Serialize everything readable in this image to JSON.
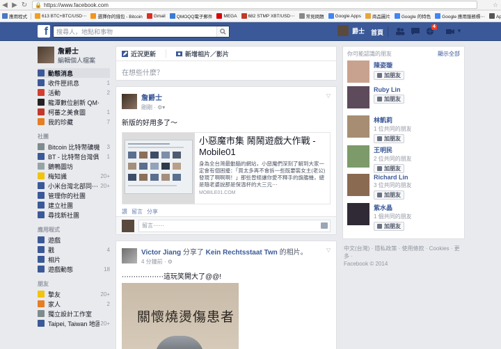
{
  "browser": {
    "url": "https://www.facebook.com",
    "bookmarks": [
      {
        "label": "應用程式",
        "color": "#4a78c2"
      },
      {
        "label": "613 BTC+BTC/USD⋯",
        "color": "#f0a020"
      },
      {
        "label": "選擇你的錢包 - Bitcoin",
        "color": "#f7931a"
      },
      {
        "label": "Gmail",
        "color": "#d93025"
      },
      {
        "label": "QMOQQ電子郵件",
        "color": "#3a7bd5"
      },
      {
        "label": "MEGA",
        "color": "#d90007"
      },
      {
        "label": "682 STMP XBT/USD⋯",
        "color": "#c0392b"
      },
      {
        "label": "常見問題",
        "color": "#888888"
      },
      {
        "label": "Google Apps",
        "color": "#4285f4"
      },
      {
        "label": "商品圖片",
        "color": "#e8a33d"
      },
      {
        "label": "Google 的特色",
        "color": "#4285f4"
      },
      {
        "label": "Google 應用服務標⋯",
        "color": "#4285f4"
      },
      {
        "label": "Apple - 台灣",
        "color": "#555555"
      }
    ]
  },
  "header": {
    "search_placeholder": "搜尋人，地點和事物",
    "profile_name": "爵士",
    "home_label": "首頁",
    "notification_count": "4"
  },
  "left": {
    "user_name": "詹爵士",
    "edit_profile": "編輯個人檔案",
    "items": [
      {
        "label": "動態消息",
        "count": "",
        "active": true,
        "color": "#3b5998"
      },
      {
        "label": "收件匣訊息",
        "count": "1",
        "color": "#3b5998"
      },
      {
        "label": "活動",
        "count": "2",
        "color": "#d23f31"
      },
      {
        "label": "龍潭數位創新 QM⋯",
        "count": "",
        "color": "#222222"
      },
      {
        "label": "柯蕃之美食圖",
        "count": "1",
        "color": "#c0392b"
      },
      {
        "label": "我的珍藏",
        "count": "7",
        "color": "#e67e22"
      }
    ],
    "groups_header": "社團",
    "groups": [
      {
        "label": "Bitcoin 比特幣礦機⋯",
        "count": "3",
        "color": "#7f8c8d"
      },
      {
        "label": "BT - 比特幣台灣俱⋯",
        "count": "1",
        "color": "#3b5998"
      },
      {
        "label": "鵝鴨圖坊",
        "count": "",
        "color": "#95a5a6"
      },
      {
        "label": "梅知識",
        "count": "20+",
        "color": "#f1c40f"
      },
      {
        "label": "小米台灣北部同⋯",
        "count": "20+",
        "color": "#3b5998"
      },
      {
        "label": "管理你的社團",
        "count": "",
        "color": "#3b5998"
      },
      {
        "label": "建立社團",
        "count": "",
        "color": "#3b5998"
      },
      {
        "label": "尋找新社團",
        "count": "",
        "color": "#3b5998"
      }
    ],
    "apps_header": "應用程式",
    "apps": [
      {
        "label": "遊戲",
        "count": "",
        "color": "#3b5998"
      },
      {
        "label": "戳",
        "count": "4",
        "color": "#3b5998"
      },
      {
        "label": "相片",
        "count": "",
        "color": "#3b5998"
      },
      {
        "label": "遊戲動態",
        "count": "18",
        "color": "#3b5998"
      }
    ],
    "friends_header": "朋友",
    "friends": [
      {
        "label": "摯友",
        "count": "20+",
        "color": "#f1c40f"
      },
      {
        "label": "家人",
        "count": "2",
        "color": "#e67e22"
      },
      {
        "label": "獨立設計工作室",
        "count": "",
        "color": "#7f8c8d"
      },
      {
        "label": "Taipei, Taiwan 地區",
        "count": "20+",
        "color": "#3b5998"
      }
    ]
  },
  "composer": {
    "status_tab": "近況更新",
    "photo_tab": "新增相片／影片",
    "placeholder": "在想些什麼？"
  },
  "post1": {
    "author": "詹爵士",
    "time": "剛剛",
    "text": "新版的好用多了～",
    "link_title": "小惡魔市集 鬧鬧遊戲大作戰 - Mobile01",
    "link_desc": "身為全台灣最動腦的網站，小惡魔們深刻了解到大家一定會有個困擾：「買太多再不會拆一些既要裝女主(老公)發現了啊啊啊！」那些曾經讓你愛不釋手的旗艦機，總是隨老婆說那是保溫杯的大三元⋯",
    "link_source": "MOBILE01.COM",
    "actions": [
      "讚",
      "留言",
      "分享"
    ],
    "comment_placeholder": "留言⋯⋯"
  },
  "post2": {
    "author": "Victor Jiang",
    "shared_text": "分享了",
    "page_name": "Kein Rechtsstaat Twn",
    "suffix": "的相片。",
    "time": "4 分鐘前",
    "text": "⋯⋯⋯⋯⋯⋯這玩笑開大了@@!",
    "image_caption": "關懷燒燙傷患者"
  },
  "right": {
    "title": "你可能認識的朋友",
    "see_all": "顯示全部",
    "add_label": "加朋友",
    "people": [
      {
        "name": "陳姿璇",
        "mutual": "",
        "color": "#c9a28f"
      },
      {
        "name": "Ruby Lin",
        "mutual": "",
        "color": "#5d4a5a"
      },
      {
        "name": "林凱莉",
        "mutual": "1 位共同的朋友",
        "color": "#a78d72"
      },
      {
        "name": "王明民",
        "mutual": "2 位共同的朋友",
        "color": "#7c9a6a"
      },
      {
        "name": "Richard Lin",
        "mutual": "3 位共同的朋友",
        "color": "#8b6a52"
      },
      {
        "name": "紫水晶",
        "mutual": "1 個共同的朋友",
        "color": "#2f2a35"
      }
    ]
  },
  "footer": {
    "links": "中文(台灣) · 隱私政策 · 使用條款 · Cookies · 更多 ·",
    "copyright": "Facebook © 2014"
  },
  "colors": {
    "brand": "#3b5998",
    "link": "#3b5998",
    "badge": "#f03d25"
  },
  "icons": [
    "back-icon",
    "forward-icon",
    "reload-icon",
    "lock-icon",
    "star-icon",
    "search-icon",
    "friends-icon",
    "messages-icon",
    "globe-icon",
    "settings-icon",
    "camera-icon"
  ]
}
